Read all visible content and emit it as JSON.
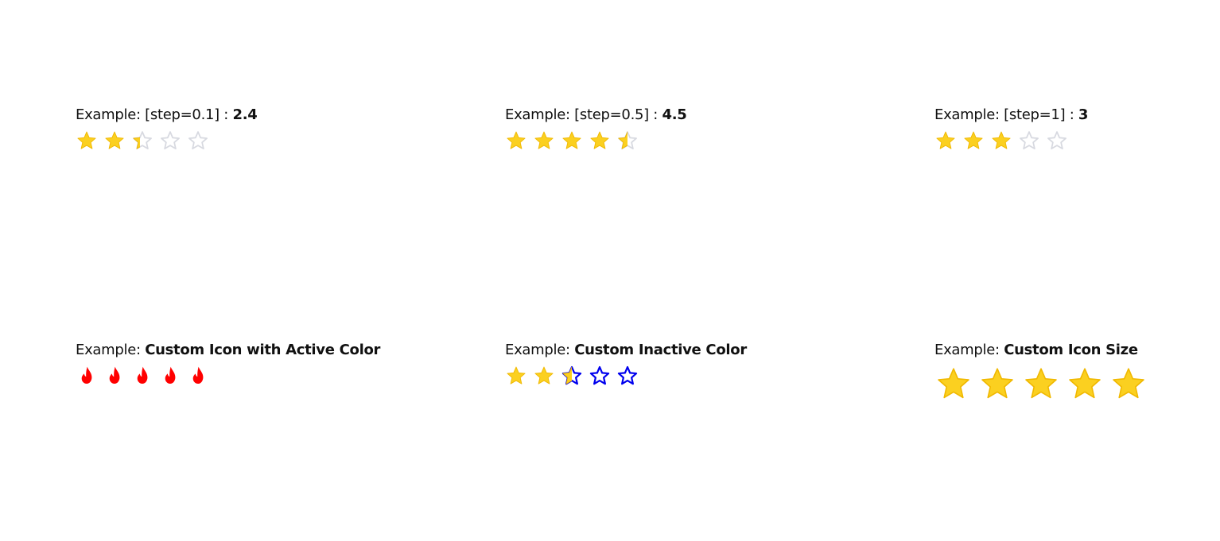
{
  "colors": {
    "active": "#fbd020",
    "active_stroke": "#f0b800",
    "inactive_stroke": "#d7d9e0",
    "custom_active": "#ff0000",
    "custom_inactive_stroke": "#0000ee"
  },
  "examples": [
    {
      "label_prefix": "Example: [step=0.1] : ",
      "label_value": "2.4",
      "icon": "star-icon",
      "value": 2.4,
      "max": 5,
      "step": 0.1
    },
    {
      "label_prefix": "Example: [step=0.5] : ",
      "label_value": "4.5",
      "icon": "star-icon",
      "value": 4.5,
      "max": 5,
      "step": 0.5
    },
    {
      "label_prefix": "Example: [step=1] : ",
      "label_value": "3",
      "icon": "star-icon",
      "value": 3,
      "max": 5,
      "step": 1
    },
    {
      "label_prefix": "Example: ",
      "label_value": "Custom Icon with Active Color",
      "icon": "fire-icon",
      "value": 5,
      "max": 5,
      "active_color": "#ff0000"
    },
    {
      "label_prefix": "Example: ",
      "label_value": "Custom Inactive Color",
      "icon": "star-icon",
      "value": 2.5,
      "max": 5,
      "inactive_color": "#0000ee"
    },
    {
      "label_prefix": "Example: ",
      "label_value": "Custom Icon Size",
      "icon": "star-icon",
      "value": 5,
      "max": 5
    }
  ]
}
